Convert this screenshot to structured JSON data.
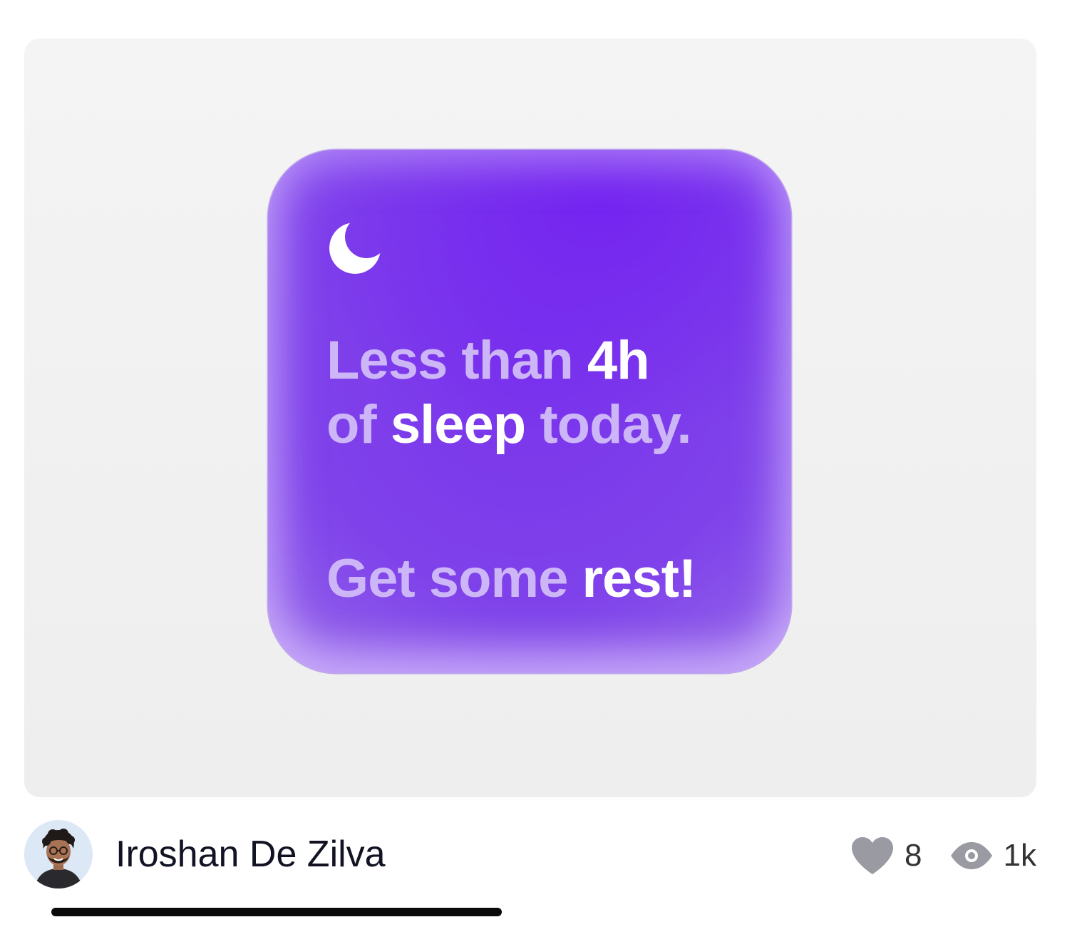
{
  "shot": {
    "widget": {
      "line1": {
        "part1": "Less than ",
        "part2": "4h"
      },
      "line2": {
        "part1": "of ",
        "part2": "sleep",
        "part3": " today."
      },
      "line3": {
        "part1": "Get some ",
        "part2": "rest!"
      },
      "icon": "moon-icon"
    }
  },
  "author": {
    "name": "Iroshan De Zilva",
    "avatar": "avatar-photo"
  },
  "stats": {
    "likes": "8",
    "views": "1k",
    "like_icon": "heart-icon",
    "view_icon": "eye-icon"
  },
  "colors": {
    "widget_purple": "#7a34ec",
    "text_dim": "#cdb6f7",
    "text_bright": "#ffffff",
    "stat_icon": "#9a9aa2"
  }
}
